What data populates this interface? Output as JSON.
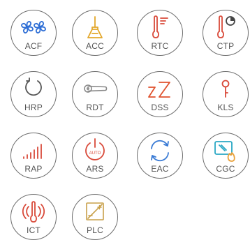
{
  "tiles": [
    {
      "label": "ACF",
      "icon": "fan-icon",
      "color": "#2f6fd6"
    },
    {
      "label": "ACC",
      "icon": "broom-icon",
      "color": "#e3a72b"
    },
    {
      "label": "RTC",
      "icon": "thermometer-icon",
      "color": "#d94a3a"
    },
    {
      "label": "CTP",
      "icon": "thermometer-clock-icon",
      "color": "#d94a3a"
    },
    {
      "label": "HRP",
      "icon": "refresh-icon",
      "color": "#555555"
    },
    {
      "label": "RDT",
      "icon": "door-handle-icon",
      "color": "#8a8a8a"
    },
    {
      "label": "DSS",
      "icon": "sleep-icon",
      "color": "#e0522e"
    },
    {
      "label": "KLS",
      "icon": "key-icon",
      "color": "#d94a3a"
    },
    {
      "label": "RAP",
      "icon": "signal-bars-icon",
      "color": "#d94a3a"
    },
    {
      "label": "ARS",
      "icon": "auto-power-icon",
      "color": "#d94a3a",
      "text": "AUTO"
    },
    {
      "label": "EAC",
      "icon": "cycle-arrows-icon",
      "color": "#3a7bd5"
    },
    {
      "label": "CGC",
      "icon": "card-flame-icon",
      "color": "#2aa8c4",
      "accent": "#e9a23b"
    },
    {
      "label": "ICT",
      "icon": "thermometer-alarm-icon",
      "color": "#d94a3a"
    },
    {
      "label": "PLC",
      "icon": "plug-load-icon",
      "color": "#c8a04a"
    }
  ]
}
